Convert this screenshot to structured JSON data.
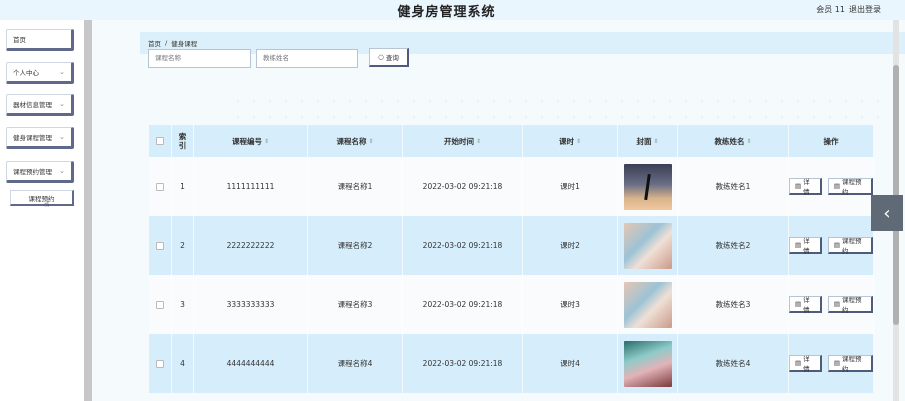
{
  "header": {
    "title": "健身房管理系统",
    "user": "会员 11",
    "logout": "退出登录"
  },
  "sidebar": {
    "items": [
      {
        "label": "首页"
      },
      {
        "label": "个人中心"
      },
      {
        "label": "器材信息管理"
      },
      {
        "label": "健身课程管理"
      },
      {
        "label": "课程预约管理"
      }
    ],
    "sub_items": [
      {
        "label": "课程预约"
      }
    ]
  },
  "breadcrumb": {
    "home": "首页",
    "separator": "/",
    "current": "健身课程"
  },
  "search": {
    "course_name_placeholder": "课程名称",
    "coach_name_placeholder": "教练姓名",
    "button_label": "查询"
  },
  "table": {
    "headers": {
      "index_line1": "索",
      "index_line2": "引",
      "course_no": "课程编号",
      "course_name": "课程名称",
      "start_time": "开始时间",
      "hours": "课时",
      "cover": "封面",
      "coach": "教练姓名",
      "actions": "操作"
    },
    "rows": [
      {
        "index": "1",
        "course_no": "1111111111",
        "course_name": "课程名称1",
        "start_time": "2022-03-02 09:21:18",
        "hours": "课时1",
        "coach": "教练姓名1",
        "cover_icon": "yoga-photo"
      },
      {
        "index": "2",
        "course_no": "2222222222",
        "course_name": "课程名称2",
        "start_time": "2022-03-02 09:21:18",
        "hours": "课时2",
        "coach": "教练姓名2",
        "cover_icon": "gym-class-photo"
      },
      {
        "index": "3",
        "course_no": "3333333333",
        "course_name": "课程名称3",
        "start_time": "2022-03-02 09:21:18",
        "hours": "课时3",
        "coach": "教练姓名3",
        "cover_icon": "gym-class-photo"
      },
      {
        "index": "4",
        "course_no": "4444444444",
        "course_name": "课程名称4",
        "start_time": "2022-03-02 09:21:18",
        "hours": "课时4",
        "coach": "教练姓名4",
        "cover_icon": "spin-class-photo"
      }
    ],
    "detail_label": "详情",
    "reserve_label": "课程预约"
  },
  "colors": {
    "header_bg": "#eaf6fd",
    "row_alt_bg": "#d6eefb",
    "button_shadow": "#4f5b7d"
  }
}
